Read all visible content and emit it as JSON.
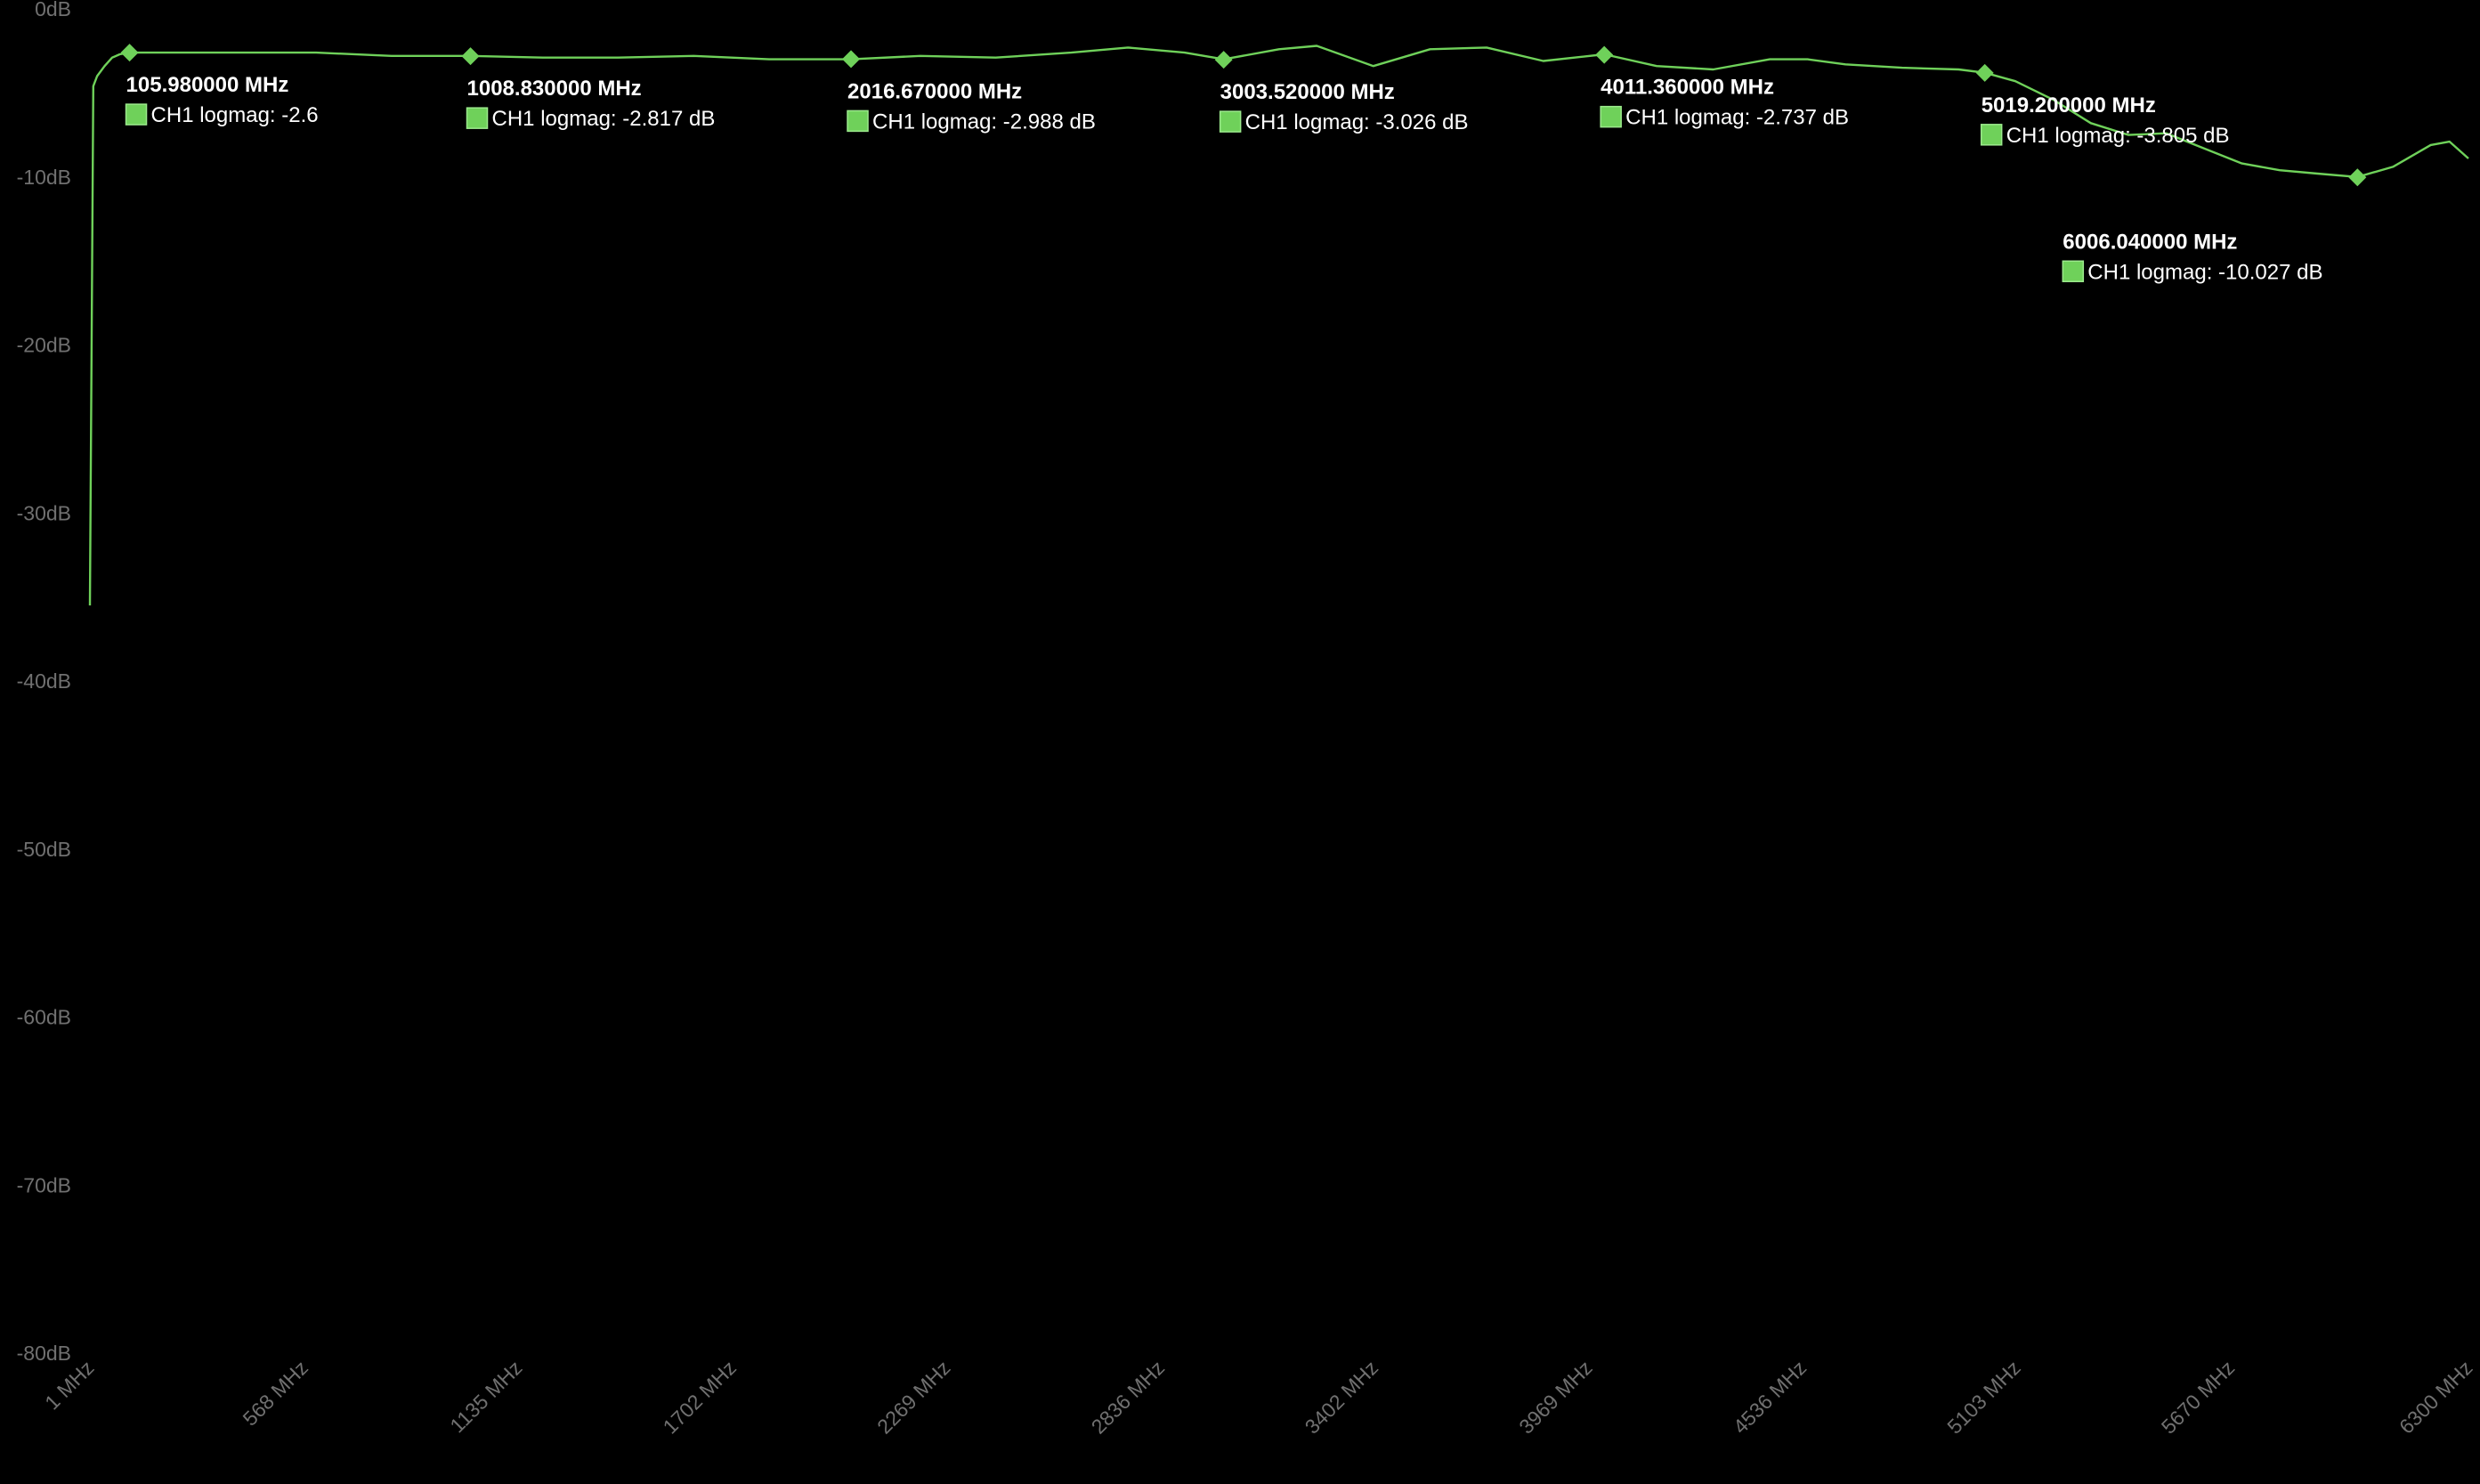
{
  "chart_data": {
    "type": "line",
    "title": "",
    "xlabel": "",
    "ylabel": "",
    "background_color": "#000000",
    "trace_color": "#6fd15a",
    "marker_color": "#6fd15a",
    "tick_label_color": "#707070",
    "annotation_text_color": "#ffffff",
    "grid": false,
    "x_unit": "MHz",
    "xlim": [
      1,
      6300
    ],
    "ylim": [
      -80,
      0
    ],
    "x_ticks": [
      1,
      568,
      1135,
      1702,
      2269,
      2836,
      3402,
      3969,
      4536,
      5103,
      5670,
      6300
    ],
    "x_tick_labels": [
      "1 MHz",
      "568 MHz",
      "1135 MHz",
      "1702 MHz",
      "2269 MHz",
      "2836 MHz",
      "3402 MHz",
      "3969 MHz",
      "4536 MHz",
      "5103 MHz",
      "5670 MHz",
      "6300 MHz"
    ],
    "y_ticks": [
      0,
      -10,
      -20,
      -30,
      -40,
      -50,
      -60,
      -70,
      -80
    ],
    "y_tick_labels": [
      "0dB",
      "-10dB",
      "-20dB",
      "-30dB",
      "-40dB",
      "-50dB",
      "-60dB",
      "-70dB",
      "-80dB"
    ],
    "series": [
      {
        "name": "CH1 logmag",
        "x": [
          1,
          10,
          20,
          40,
          60,
          80,
          105.98,
          200,
          400,
          600,
          800,
          1008.83,
          1200,
          1400,
          1600,
          1800,
          2016.67,
          2200,
          2400,
          2600,
          2750,
          2900,
          3003.52,
          3150,
          3250,
          3400,
          3550,
          3700,
          3850,
          4011.36,
          4150,
          4300,
          4450,
          4550,
          4650,
          4800,
          4950,
          5019.2,
          5100,
          5200,
          5300,
          5400,
          5500,
          5600,
          5700,
          5800,
          5900,
          6006.04,
          6100,
          6200,
          6250,
          6300
        ],
        "y": [
          -35.5,
          -4.6,
          -4.0,
          -3.4,
          -2.9,
          -2.7,
          -2.6,
          -2.6,
          -2.6,
          -2.6,
          -2.8,
          -2.8,
          -2.9,
          -2.9,
          -2.8,
          -3.0,
          -3.0,
          -2.8,
          -2.9,
          -2.6,
          -2.3,
          -2.6,
          -3.0,
          -2.4,
          -2.2,
          -3.4,
          -2.4,
          -2.3,
          -3.1,
          -2.7,
          -3.4,
          -3.6,
          -3.0,
          -3.0,
          -3.3,
          -3.5,
          -3.6,
          -3.8,
          -4.3,
          -5.4,
          -6.8,
          -7.5,
          -7.4,
          -8.3,
          -9.2,
          -9.6,
          -9.8,
          -10.0,
          -9.4,
          -8.1,
          -7.9,
          -8.9
        ]
      }
    ],
    "markers": [
      {
        "frequency": "105.980000 MHz",
        "reading": "CH1 logmag: -2.6",
        "x": 105.98,
        "y": -2.6
      },
      {
        "frequency": "1008.830000 MHz",
        "reading": "CH1 logmag: -2.817 dB",
        "x": 1008.83,
        "y": -2.817
      },
      {
        "frequency": "2016.670000 MHz",
        "reading": "CH1 logmag: -2.988 dB",
        "x": 2016.67,
        "y": -2.988
      },
      {
        "frequency": "3003.520000 MHz",
        "reading": "CH1 logmag: -3.026 dB",
        "x": 3003.52,
        "y": -3.026
      },
      {
        "frequency": "4011.360000 MHz",
        "reading": "CH1 logmag: -2.737 dB",
        "x": 4011.36,
        "y": -2.737
      },
      {
        "frequency": "5019.200000 MHz",
        "reading": "CH1 logmag: -3.805 dB",
        "x": 5019.2,
        "y": -3.805
      },
      {
        "frequency": "6006.040000 MHz",
        "reading": "CH1 logmag: -10.027 dB",
        "x": 6006.04,
        "y": -10.027
      }
    ]
  }
}
